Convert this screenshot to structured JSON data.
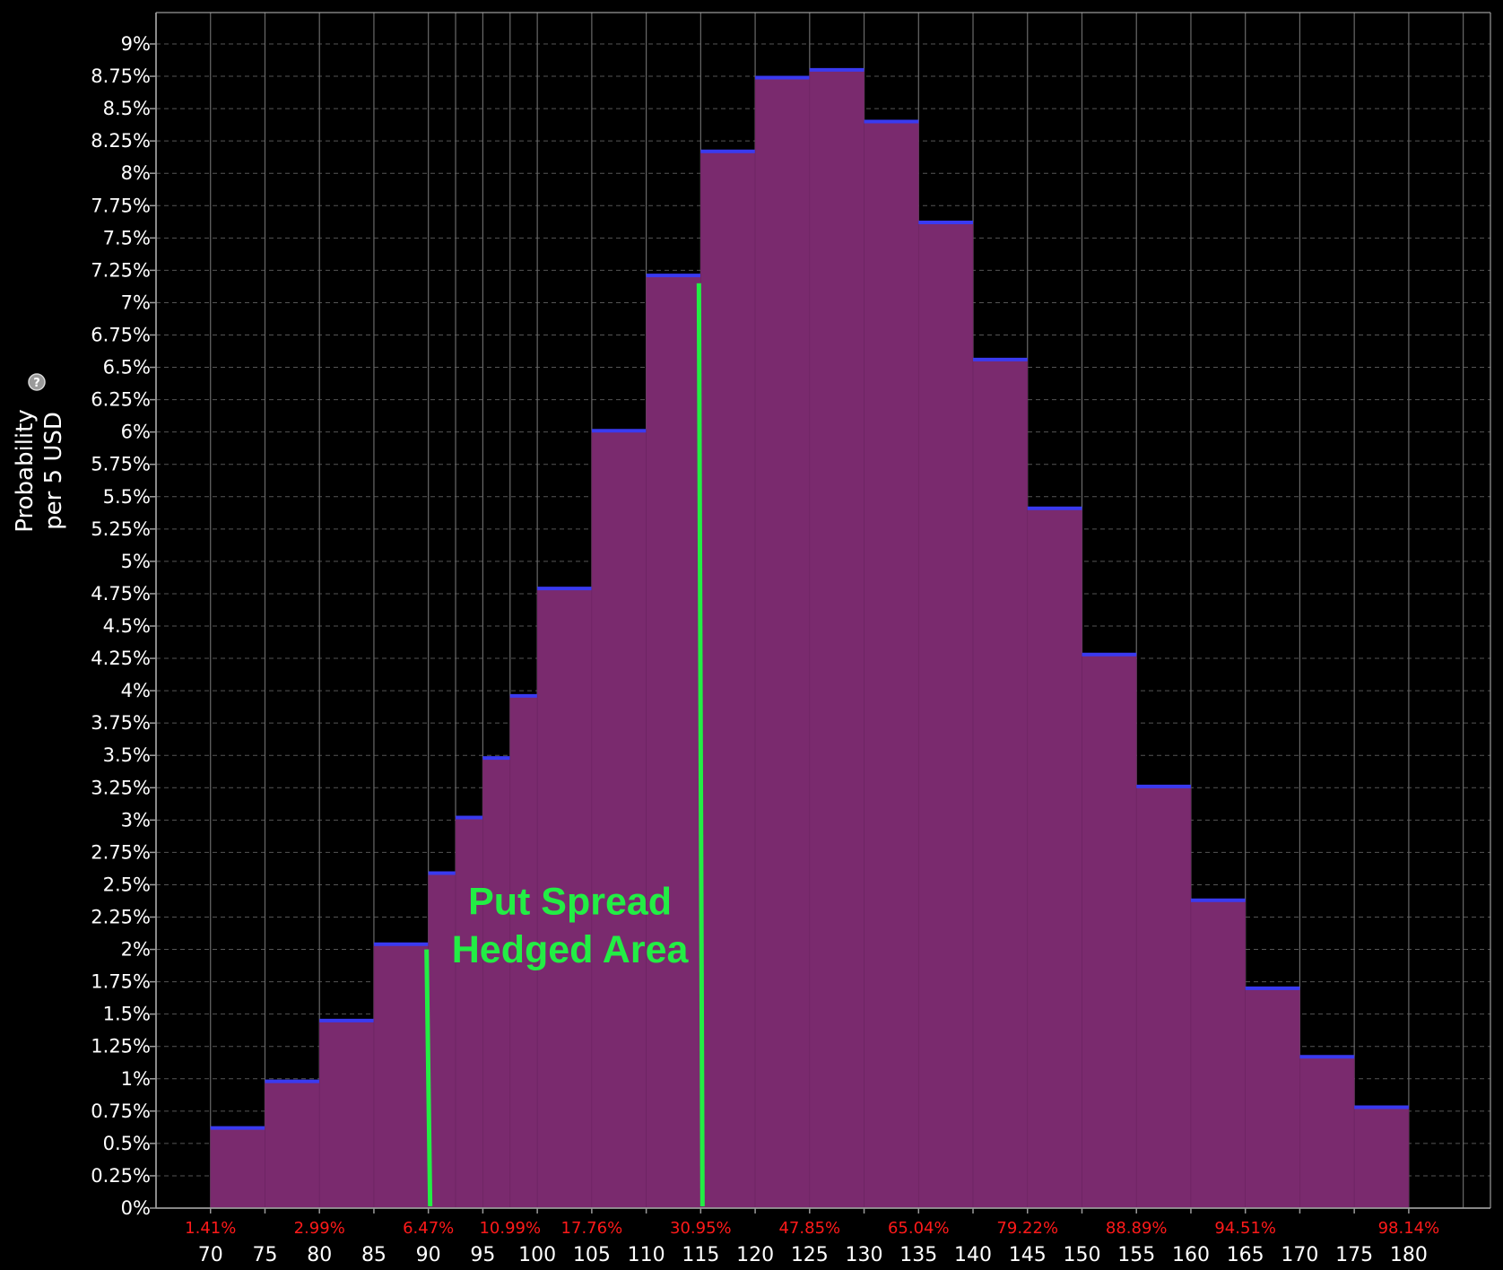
{
  "chart_data": {
    "type": "bar",
    "ylabel_line1": "Probability",
    "ylabel_line2": "per 5 USD",
    "help_icon": "question-circle-icon",
    "ylim": [
      0,
      9
    ],
    "xlim": [
      65,
      187.5
    ],
    "y_ticks": [
      "0%",
      "0.25%",
      "0.5%",
      "0.75%",
      "1%",
      "1.25%",
      "1.5%",
      "1.75%",
      "2%",
      "2.25%",
      "2.5%",
      "2.75%",
      "3%",
      "3.25%",
      "3.5%",
      "3.75%",
      "4%",
      "4.25%",
      "4.5%",
      "4.75%",
      "5%",
      "5.25%",
      "5.5%",
      "5.75%",
      "6%",
      "6.25%",
      "6.5%",
      "6.75%",
      "7%",
      "7.25%",
      "7.5%",
      "7.75%",
      "8%",
      "8.25%",
      "8.5%",
      "8.75%",
      "9%"
    ],
    "x_ticks": [
      70,
      75,
      80,
      85,
      90,
      95,
      100,
      105,
      110,
      115,
      120,
      125,
      130,
      135,
      140,
      145,
      150,
      155,
      160,
      165,
      170,
      175,
      180
    ],
    "vertical_gridlines_x": [
      70,
      75,
      80,
      85,
      90,
      92.5,
      95,
      97.5,
      100,
      105,
      110,
      115,
      120,
      125,
      130,
      135,
      140,
      145,
      150,
      155,
      160,
      165,
      170,
      175,
      180,
      185
    ],
    "bins": [
      {
        "from": 70,
        "to": 75,
        "value": 0.62
      },
      {
        "from": 75,
        "to": 80,
        "value": 0.98
      },
      {
        "from": 80,
        "to": 85,
        "value": 1.45
      },
      {
        "from": 85,
        "to": 90,
        "value": 2.04
      },
      {
        "from": 90,
        "to": 92.5,
        "value": 2.59
      },
      {
        "from": 92.5,
        "to": 95,
        "value": 3.02
      },
      {
        "from": 95,
        "to": 97.5,
        "value": 3.48
      },
      {
        "from": 97.5,
        "to": 100,
        "value": 3.96
      },
      {
        "from": 100,
        "to": 105,
        "value": 4.79
      },
      {
        "from": 105,
        "to": 110,
        "value": 6.01
      },
      {
        "from": 110,
        "to": 115,
        "value": 7.21
      },
      {
        "from": 115,
        "to": 120,
        "value": 8.17
      },
      {
        "from": 120,
        "to": 125,
        "value": 8.74
      },
      {
        "from": 125,
        "to": 130,
        "value": 8.8
      },
      {
        "from": 130,
        "to": 135,
        "value": 8.4
      },
      {
        "from": 135,
        "to": 140,
        "value": 7.62
      },
      {
        "from": 140,
        "to": 145,
        "value": 6.56
      },
      {
        "from": 145,
        "to": 150,
        "value": 5.41
      },
      {
        "from": 150,
        "to": 155,
        "value": 4.28
      },
      {
        "from": 155,
        "to": 160,
        "value": 3.26
      },
      {
        "from": 160,
        "to": 165,
        "value": 2.38
      },
      {
        "from": 165,
        "to": 170,
        "value": 1.7
      },
      {
        "from": 170,
        "to": 175,
        "value": 1.17
      },
      {
        "from": 175,
        "to": 180,
        "value": 0.78
      }
    ],
    "cumulative_labels": [
      {
        "x": 70,
        "label": "1.41%"
      },
      {
        "x": 80,
        "label": "2.99%"
      },
      {
        "x": 90,
        "label": "6.47%"
      },
      {
        "x": 97.5,
        "label": "10.99%"
      },
      {
        "x": 105,
        "label": "17.76%"
      },
      {
        "x": 115,
        "label": "30.95%"
      },
      {
        "x": 125,
        "label": "47.85%"
      },
      {
        "x": 135,
        "label": "65.04%"
      },
      {
        "x": 145,
        "label": "79.22%"
      },
      {
        "x": 155,
        "label": "88.89%"
      },
      {
        "x": 165,
        "label": "94.51%"
      },
      {
        "x": 180,
        "label": "98.14%"
      }
    ],
    "hedge_lines": [
      {
        "x_top": 90,
        "x_bottom": 90,
        "y_top": 2.0,
        "y_bottom": 0
      },
      {
        "x_top": 115,
        "x_bottom": 115,
        "y_top": 7.15,
        "y_bottom": 0
      }
    ],
    "annotation": {
      "line1": "Put Spread",
      "line2": "Hedged Area",
      "x": 103,
      "y_line1": 2.27,
      "y_line2": 1.9
    },
    "colors": {
      "background": "#000000",
      "bar_fill": "#7a2a6e",
      "bar_top": "#3a3af0",
      "grid_dash": "#555555",
      "vgrid": "#6a6a6a",
      "axis": "#9a9a9a",
      "cumulative_text": "#ff1a1a",
      "hedge": "#22ee44"
    }
  }
}
